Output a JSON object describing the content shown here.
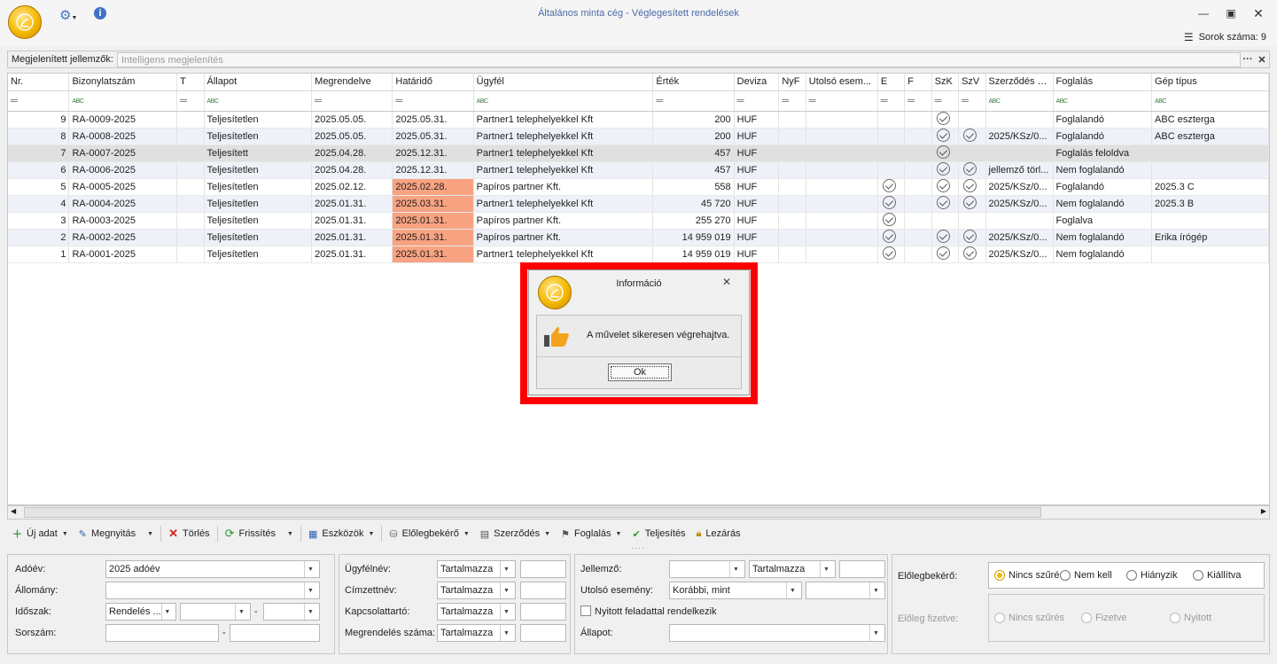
{
  "window": {
    "title": "Általános minta cég - Véglegesített rendelések",
    "row_count": "Sorok száma: 9"
  },
  "features": {
    "label": "Megjelenített jellemzők:",
    "placeholder": "Intelligens megjelenítés",
    "more": "···",
    "close": "✕"
  },
  "grid": {
    "columns": [
      "Nr.",
      "Bizonylatszám",
      "T",
      "Állapot",
      "Megrendelve",
      "Határidő",
      "Ügyfél",
      "Érték",
      "Deviza",
      "NyF",
      "Utolsó esem...",
      "E",
      "F",
      "SzK",
      "SzV",
      "Szerződés Nr.",
      "Foglalás",
      "Gép típus"
    ],
    "filter_eq": "═",
    "filter_abc": "ABC",
    "rows": [
      {
        "nr": "9",
        "bizonylat": "RA-0009-2025",
        "allapot": "Teljesítetlen",
        "megrendelve": "2025.05.05.",
        "hatarido": "2025.05.31.",
        "ugyfel": "Partner1 telephelyekkel Kft",
        "ertek": "200",
        "deviza": "HUF",
        "e": false,
        "szk": true,
        "szv": false,
        "szerzodes": "",
        "foglalas": "Foglalandó",
        "gep": "ABC eszterga",
        "overdue": false
      },
      {
        "nr": "8",
        "bizonylat": "RA-0008-2025",
        "allapot": "Teljesítetlen",
        "megrendelve": "2025.05.05.",
        "hatarido": "2025.05.31.",
        "ugyfel": "Partner1 telephelyekkel Kft",
        "ertek": "200",
        "deviza": "HUF",
        "e": false,
        "szk": true,
        "szv": true,
        "szerzodes": "2025/KSz/0...",
        "foglalas": "Foglalandó",
        "gep": "ABC eszterga",
        "overdue": false
      },
      {
        "nr": "7",
        "bizonylat": "RA-0007-2025",
        "allapot": "Teljesített",
        "megrendelve": "2025.04.28.",
        "hatarido": "2025.12.31.",
        "ugyfel": "Partner1 telephelyekkel Kft",
        "ertek": "457",
        "deviza": "HUF",
        "e": false,
        "szk": true,
        "szv": false,
        "szerzodes": "",
        "foglalas": "Foglalás feloldva",
        "gep": "",
        "overdue": false
      },
      {
        "nr": "6",
        "bizonylat": "RA-0006-2025",
        "allapot": "Teljesítetlen",
        "megrendelve": "2025.04.28.",
        "hatarido": "2025.12.31.",
        "ugyfel": "Partner1 telephelyekkel Kft",
        "ertek": "457",
        "deviza": "HUF",
        "e": false,
        "szk": true,
        "szv": true,
        "szerzodes": "jellemző törl...",
        "foglalas": "Nem foglalandó",
        "gep": "",
        "overdue": false
      },
      {
        "nr": "5",
        "bizonylat": "RA-0005-2025",
        "allapot": "Teljesítetlen",
        "megrendelve": "2025.02.12.",
        "hatarido": "2025.02.28.",
        "ugyfel": "Papíros partner Kft.",
        "ertek": "558",
        "deviza": "HUF",
        "e": true,
        "szk": true,
        "szv": true,
        "szerzodes": "2025/KSz/0...",
        "foglalas": "Foglalandó",
        "gep": "2025.3 C",
        "overdue": true
      },
      {
        "nr": "4",
        "bizonylat": "RA-0004-2025",
        "allapot": "Teljesítetlen",
        "megrendelve": "2025.01.31.",
        "hatarido": "2025.03.31.",
        "ugyfel": "Partner1 telephelyekkel Kft",
        "ertek": "45 720",
        "deviza": "HUF",
        "e": true,
        "szk": true,
        "szv": true,
        "szerzodes": "2025/KSz/0...",
        "foglalas": "Nem foglalandó",
        "gep": "2025.3 B",
        "overdue": true
      },
      {
        "nr": "3",
        "bizonylat": "RA-0003-2025",
        "allapot": "Teljesítetlen",
        "megrendelve": "2025.01.31.",
        "hatarido": "2025.01.31.",
        "ugyfel": "Papíros partner Kft.",
        "ertek": "255 270",
        "deviza": "HUF",
        "e": true,
        "szk": false,
        "szv": false,
        "szerzodes": "",
        "foglalas": "Foglalva",
        "gep": "",
        "overdue": true
      },
      {
        "nr": "2",
        "bizonylat": "RA-0002-2025",
        "allapot": "Teljesítetlen",
        "megrendelve": "2025.01.31.",
        "hatarido": "2025.01.31.",
        "ugyfel": "Papíros partner Kft.",
        "ertek": "14 959 019",
        "deviza": "HUF",
        "e": true,
        "szk": true,
        "szv": true,
        "szerzodes": "2025/KSz/0...",
        "foglalas": "Nem foglalandó",
        "gep": "Erika írógép",
        "overdue": true
      },
      {
        "nr": "1",
        "bizonylat": "RA-0001-2025",
        "allapot": "Teljesítetlen",
        "megrendelve": "2025.01.31.",
        "hatarido": "2025.01.31.",
        "ugyfel": "Partner1 telephelyekkel Kft",
        "ertek": "14 959 019",
        "deviza": "HUF",
        "e": true,
        "szk": true,
        "szv": true,
        "szerzodes": "2025/KSz/0...",
        "foglalas": "Nem foglalandó",
        "gep": "",
        "overdue": true
      }
    ]
  },
  "toolbar": {
    "new": "Új adat",
    "open": "Megnyitás",
    "delete": "Törlés",
    "refresh": "Frissítés",
    "tools": "Eszközök",
    "advance": "Előlegbekérő",
    "contract": "Szerződés",
    "booking": "Foglalás",
    "fulfil": "Teljesítés",
    "close": "Lezárás"
  },
  "filters": {
    "adoev_label": "Adóév:",
    "adoev_value": "2025 adóév",
    "allomany_label": "Állomány:",
    "idoszak_label": "Időszak:",
    "idoszak_value": "Rendelés ...",
    "idoszak_dash": "-",
    "sorszam_label": "Sorszám:",
    "sorszam_dash": "-",
    "ugyfelnev_label": "Ügyfélnév:",
    "cimzettnev_label": "Címzettnév:",
    "kapcsolattarto_label": "Kapcsolattartó:",
    "megrendeles_label": "Megrendelés száma:",
    "contains": "Tartalmazza",
    "jellemzo_label": "Jellemző:",
    "utolso_label": "Utolsó esemény:",
    "utolso_value": "Korábbi, mint",
    "nyitott_label": "Nyitott feladattal rendelkezik",
    "allapot_label": "Állapot:",
    "elolegbekero_label": "Előlegbekérő:",
    "eloleg_fizetve_label": "Előleg fizetve:",
    "radio_nincs": "Nincs szűrés",
    "radio_nemkell": "Nem kell",
    "radio_hianyzik": "Hiányzik",
    "radio_kiallitva": "Kiállítva",
    "radio_fizetve": "Fizetve",
    "radio_nyitott": "Nyitott"
  },
  "dialog": {
    "title": "Információ",
    "message": "A művelet sikeresen végrehajtva.",
    "ok": "Ok",
    "close": "✕"
  },
  "colors": {
    "overdue": "#f9a382",
    "highlight": "#ff0000",
    "title_text": "#4a6aa8"
  }
}
